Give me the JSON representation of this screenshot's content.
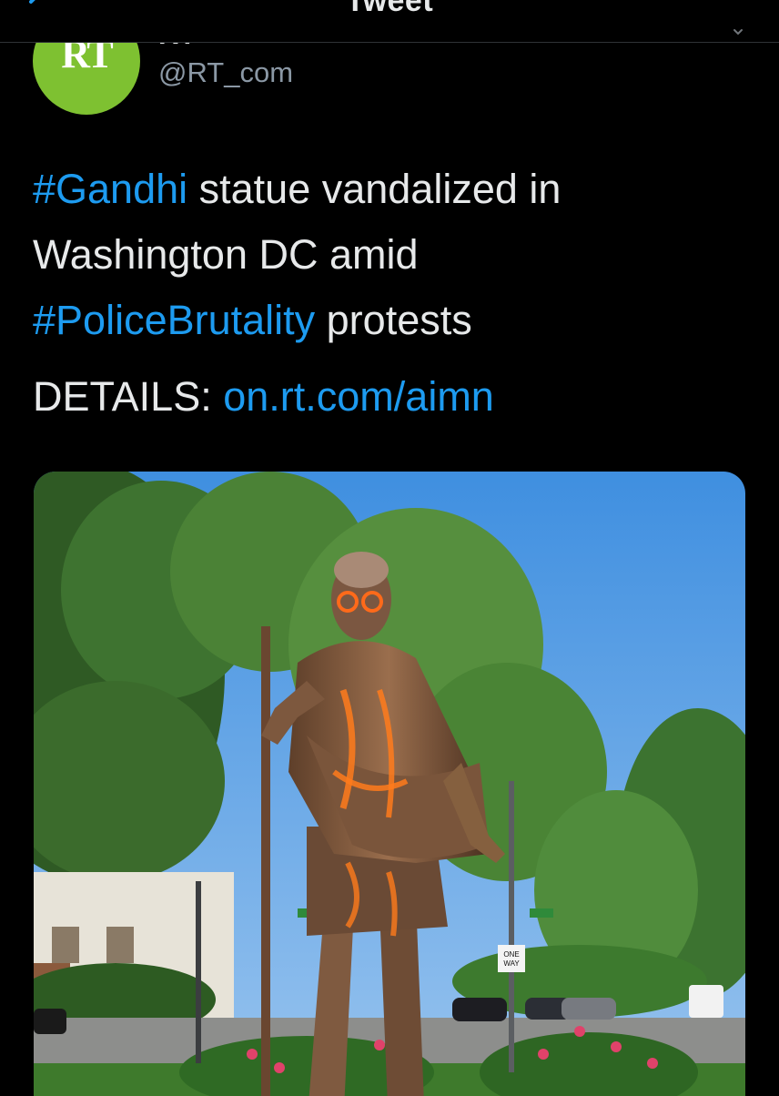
{
  "nav": {
    "title": "Tweet",
    "back_icon": "back-arrow-icon",
    "more_icon": "chevron-down-icon"
  },
  "author": {
    "display_name": "RT",
    "handle": "@RT_com",
    "avatar_text": "RT",
    "avatar_color": "#7ec131"
  },
  "tweet": {
    "line1_hashtag": "#Gandhi",
    "line1_text": " statue vandalized in",
    "line2_text": "Washington DC amid",
    "line3_hashtag": "#PoliceBrutality",
    "line3_text": " protests",
    "details_label": "DETAILS: ",
    "details_link": "on.rt.com/aimn"
  },
  "photo": {
    "sign_text_top": "ONE",
    "sign_text_bottom": "WAY"
  },
  "colors": {
    "background": "#000000",
    "text": "#e7e9ea",
    "accent": "#1d9bf0",
    "muted": "#8b98a5"
  }
}
